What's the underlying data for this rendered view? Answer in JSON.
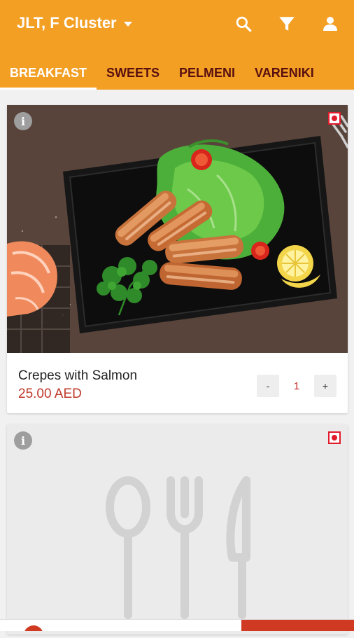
{
  "header": {
    "location": "JLT, F Cluster",
    "icons": [
      "search-icon",
      "filter-icon",
      "user-icon"
    ]
  },
  "tabs": [
    {
      "label": "BREAKFAST",
      "active": true
    },
    {
      "label": "SWEETS",
      "active": false
    },
    {
      "label": "PELMENI",
      "active": false
    },
    {
      "label": "VARENIKI",
      "active": false
    }
  ],
  "items": [
    {
      "name": "Crepes with Salmon",
      "price": "25.00 AED",
      "quantity": "1",
      "decrement": "-",
      "increment": "+",
      "info": "i",
      "image": "crepes-salmon-photo"
    },
    {
      "info": "i",
      "image": "cutlery-placeholder"
    }
  ],
  "colors": {
    "appbar": "#f29f24",
    "tab_text": "#5a1010",
    "price": "#c0392b",
    "accent_red": "#e21b2d",
    "cta": "#d03a23"
  }
}
